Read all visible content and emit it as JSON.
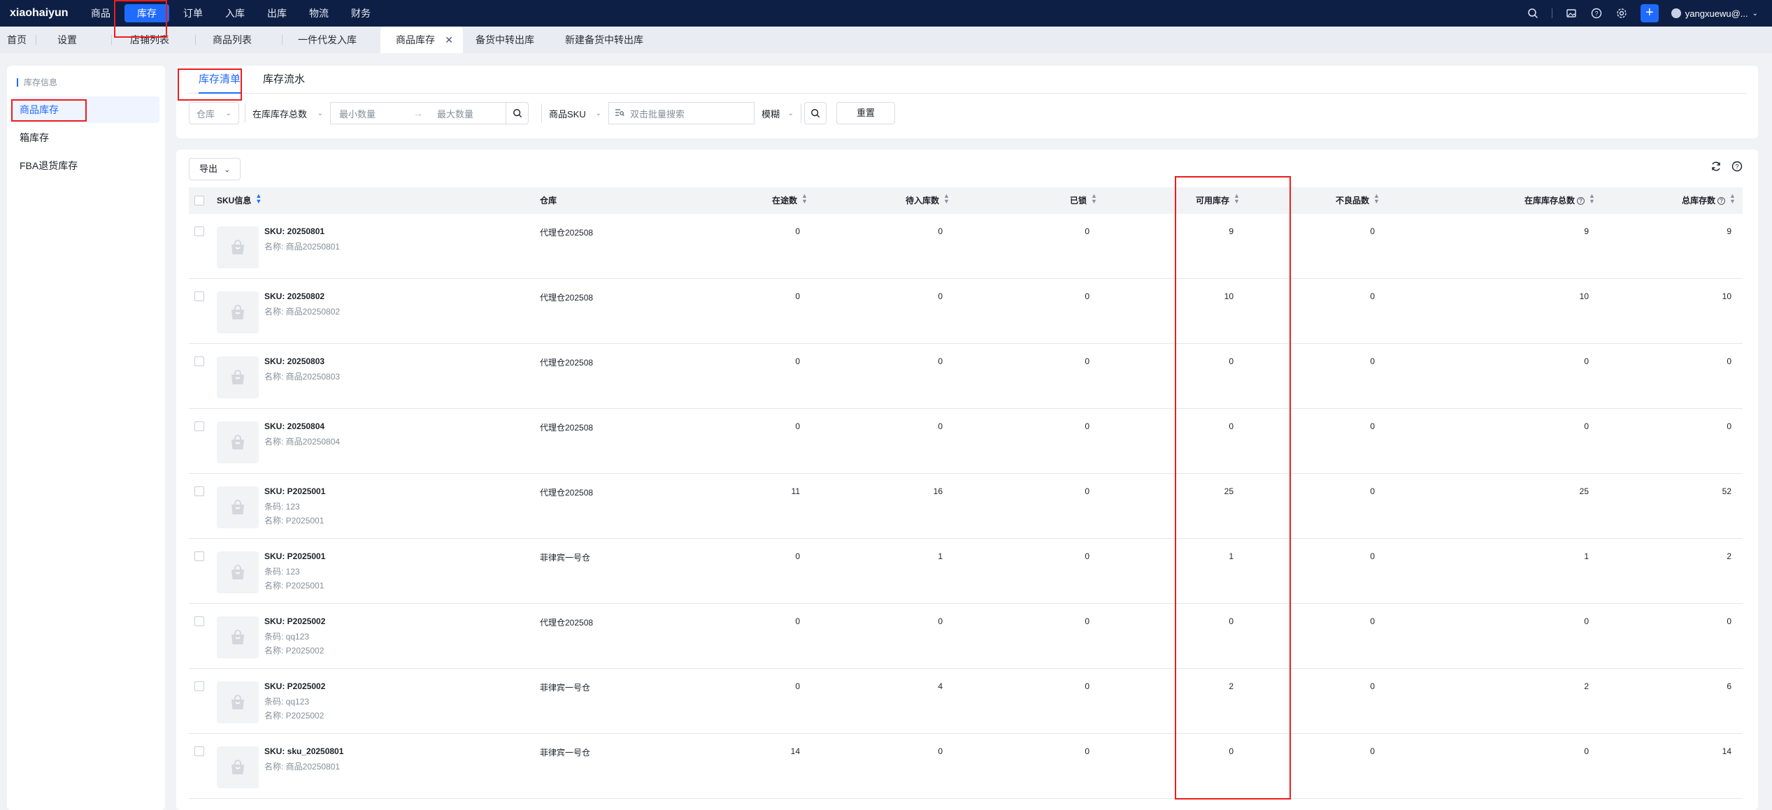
{
  "brand": "xiaohaiyun",
  "nav": [
    "商品",
    "库存",
    "订单",
    "入库",
    "出库",
    "物流",
    "财务"
  ],
  "nav_active_index": 1,
  "user": "yangxuewu@...",
  "tabs": [
    "首页",
    "设置",
    "店铺列表",
    "商品列表",
    "一件代发入库",
    "商品库存",
    "备货中转出库",
    "新建备货中转出库"
  ],
  "tab_active_index": 5,
  "sidebar": {
    "title": "库存信息",
    "items": [
      "商品库存",
      "箱库存",
      "FBA退货库存"
    ],
    "active_index": 0
  },
  "subtabs": [
    "库存清单",
    "库存流水"
  ],
  "filters": {
    "warehouse": "仓库",
    "stock_type": "在库库存总数",
    "min_placeholder": "最小数量",
    "max_placeholder": "最大数量",
    "sku_field": "商品SKU",
    "batch_placeholder": "双击批量搜索",
    "match_mode": "模糊",
    "reset": "重置"
  },
  "export": "导出",
  "columns": [
    "SKU信息",
    "仓库",
    "在途数",
    "待入库数",
    "已锁",
    "可用库存",
    "不良品数",
    "在库库存总数",
    "总库存数"
  ],
  "rows": [
    {
      "sku": "SKU: 20250801",
      "lines": [
        "名称: 商品20250801"
      ],
      "warehouse": "代理仓202508",
      "in_transit": "0",
      "pending": "0",
      "locked": "0",
      "available": "9",
      "defective": "0",
      "in_stock_total": "9",
      "total": "9"
    },
    {
      "sku": "SKU: 20250802",
      "lines": [
        "名称: 商品20250802"
      ],
      "warehouse": "代理仓202508",
      "in_transit": "0",
      "pending": "0",
      "locked": "0",
      "available": "10",
      "defective": "0",
      "in_stock_total": "10",
      "total": "10"
    },
    {
      "sku": "SKU: 20250803",
      "lines": [
        "名称: 商品20250803"
      ],
      "warehouse": "代理仓202508",
      "in_transit": "0",
      "pending": "0",
      "locked": "0",
      "available": "0",
      "defective": "0",
      "in_stock_total": "0",
      "total": "0"
    },
    {
      "sku": "SKU: 20250804",
      "lines": [
        "名称: 商品20250804"
      ],
      "warehouse": "代理仓202508",
      "in_transit": "0",
      "pending": "0",
      "locked": "0",
      "available": "0",
      "defective": "0",
      "in_stock_total": "0",
      "total": "0"
    },
    {
      "sku": "SKU: P2025001",
      "lines": [
        "条码: 123",
        "名称: P2025001"
      ],
      "warehouse": "代理仓202508",
      "in_transit": "11",
      "pending": "16",
      "locked": "0",
      "available": "25",
      "defective": "0",
      "in_stock_total": "25",
      "total": "52"
    },
    {
      "sku": "SKU: P2025001",
      "lines": [
        "条码: 123",
        "名称: P2025001"
      ],
      "warehouse": "菲律宾一号仓",
      "in_transit": "0",
      "pending": "1",
      "locked": "0",
      "available": "1",
      "defective": "0",
      "in_stock_total": "1",
      "total": "2"
    },
    {
      "sku": "SKU: P2025002",
      "lines": [
        "条码: qq123",
        "名称: P2025002"
      ],
      "warehouse": "代理仓202508",
      "in_transit": "0",
      "pending": "0",
      "locked": "0",
      "available": "0",
      "defective": "0",
      "in_stock_total": "0",
      "total": "0"
    },
    {
      "sku": "SKU: P2025002",
      "lines": [
        "条码: qq123",
        "名称: P2025002"
      ],
      "warehouse": "菲律宾一号仓",
      "in_transit": "0",
      "pending": "4",
      "locked": "0",
      "available": "2",
      "defective": "0",
      "in_stock_total": "2",
      "total": "6"
    },
    {
      "sku": "SKU: sku_20250801",
      "lines": [
        "名称: 商品20250801"
      ],
      "warehouse": "菲律宾一号仓",
      "in_transit": "14",
      "pending": "0",
      "locked": "0",
      "available": "0",
      "defective": "0",
      "in_stock_total": "0",
      "total": "14"
    }
  ],
  "colors": {
    "nav_bg": "#0e1f45",
    "accent": "#1f6bff",
    "highlight": "#ef1c1c"
  }
}
